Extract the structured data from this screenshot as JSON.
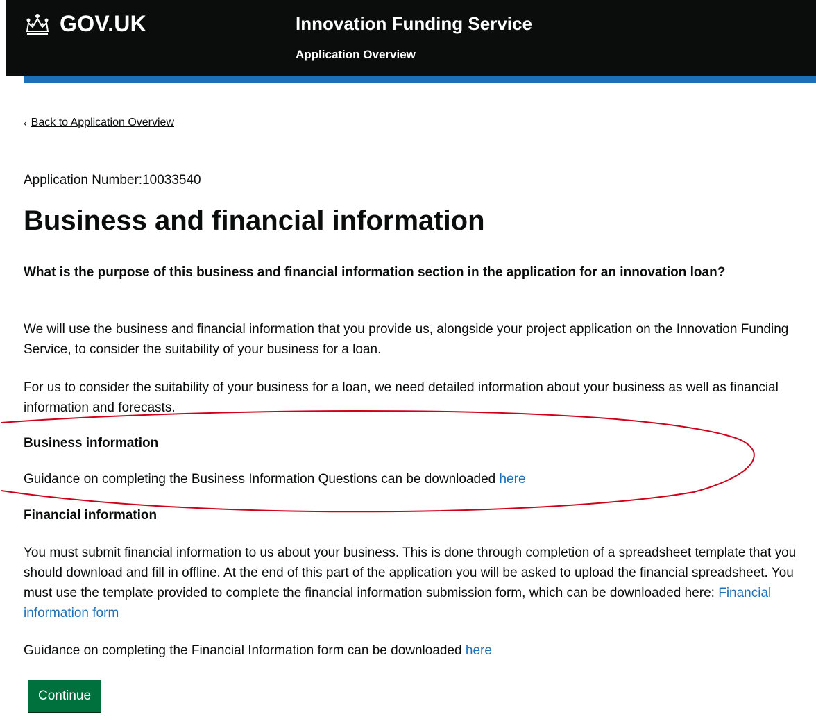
{
  "header": {
    "logo_text": "GOV.UK",
    "service_name": "Innovation Funding Service",
    "subtitle": "Application Overview"
  },
  "nav": {
    "back_link": "Back to Application Overview"
  },
  "application": {
    "number_label": "Application Number:10033540"
  },
  "main": {
    "title": "Business and financial information",
    "purpose_question": "What is the purpose of this business and financial information section in the application for an innovation loan?",
    "paragraph_1": "We will use the business and financial information that you provide us, alongside your project application on the Innovation Funding Service, to consider the suitability of your business for a loan.",
    "paragraph_2": "For us to consider the suitability of your business for a loan, we need detailed information about your business as well as financial information and forecasts.",
    "business": {
      "heading": "Business information",
      "guidance_text": "Guidance on completing the Business Information Questions can be downloaded ",
      "guidance_link": "here"
    },
    "financial": {
      "heading": "Financial information",
      "body_text": "You must submit financial information to us about your business. This is done through completion of a spreadsheet template that you should download and fill in offline. At the end of this part of the application you will be asked to upload the financial spreadsheet. You must use the template provided to complete the financial information submission form, which can be downloaded here: ",
      "form_link": "Financial information form",
      "guidance_text": "Guidance on completing the Financial Information form can be downloaded ",
      "guidance_link": "here"
    },
    "continue_label": "Continue"
  },
  "colors": {
    "header_bg": "#0b0c0c",
    "accent_bar": "#1d70b8",
    "link": "#1d70b8",
    "button": "#00703c",
    "annotation": "#d0021b"
  }
}
